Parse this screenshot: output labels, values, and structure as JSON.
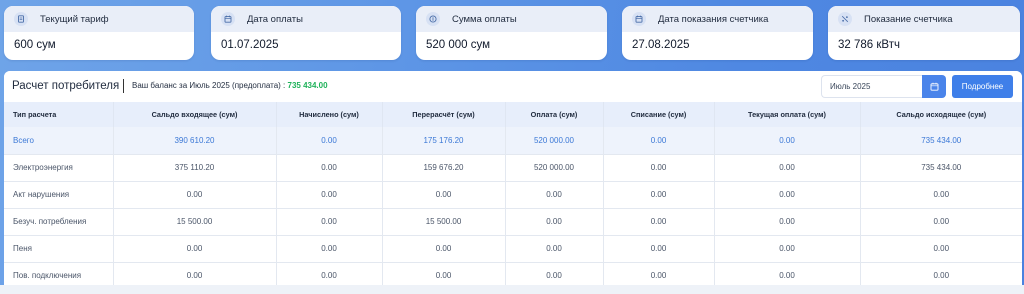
{
  "cards": [
    {
      "title": "Текущий тариф",
      "value": "600 сум",
      "icon": "document-icon"
    },
    {
      "title": "Дата оплаты",
      "value": "01.07.2025",
      "icon": "calendar-icon"
    },
    {
      "title": "Сумма оплаты",
      "value": "520 000 сум",
      "icon": "coin-icon"
    },
    {
      "title": "Дата показания счетчика",
      "value": "27.08.2025",
      "icon": "calendar-icon"
    },
    {
      "title": "Показание счетчика",
      "value": "32 786  кВтч",
      "icon": "meter-icon"
    }
  ],
  "panel": {
    "title": "Расчет потребителя",
    "balance_label": "Ваш баланс за Июль 2025 (предоплата) : ",
    "balance_value": "735 434.00",
    "month_value": "Июль 2025",
    "details_label": "Подробнее"
  },
  "table": {
    "headers": [
      "Тип расчета",
      "Сальдо входящее (сум)",
      "Начислено (сум)",
      "Перерасчёт (сум)",
      "Оплата (сум)",
      "Списание (сум)",
      "Текущая оплата (сум)",
      "Сальдо исходящее (сум)"
    ],
    "rows": [
      [
        "Всего",
        "390 610.20",
        "0.00",
        "175 176.20",
        "520 000.00",
        "0.00",
        "0.00",
        "735 434.00"
      ],
      [
        "Электроэнергия",
        "375 110.20",
        "0.00",
        "159 676.20",
        "520 000.00",
        "0.00",
        "0.00",
        "735 434.00"
      ],
      [
        "Акт нарушения",
        "0.00",
        "0.00",
        "0.00",
        "0.00",
        "0.00",
        "0.00",
        "0.00"
      ],
      [
        "Безуч. потребления",
        "15 500.00",
        "0.00",
        "15 500.00",
        "0.00",
        "0.00",
        "0.00",
        "0.00"
      ],
      [
        "Пеня",
        "0.00",
        "0.00",
        "0.00",
        "0.00",
        "0.00",
        "0.00",
        "0.00"
      ],
      [
        "Пов. подключения",
        "0.00",
        "0.00",
        "0.00",
        "0.00",
        "0.00",
        "0.00",
        "0.00"
      ]
    ]
  },
  "colors": {
    "accent": "#3f7fe9",
    "balance": "#1fb25a",
    "total_text": "#3b78d6"
  }
}
